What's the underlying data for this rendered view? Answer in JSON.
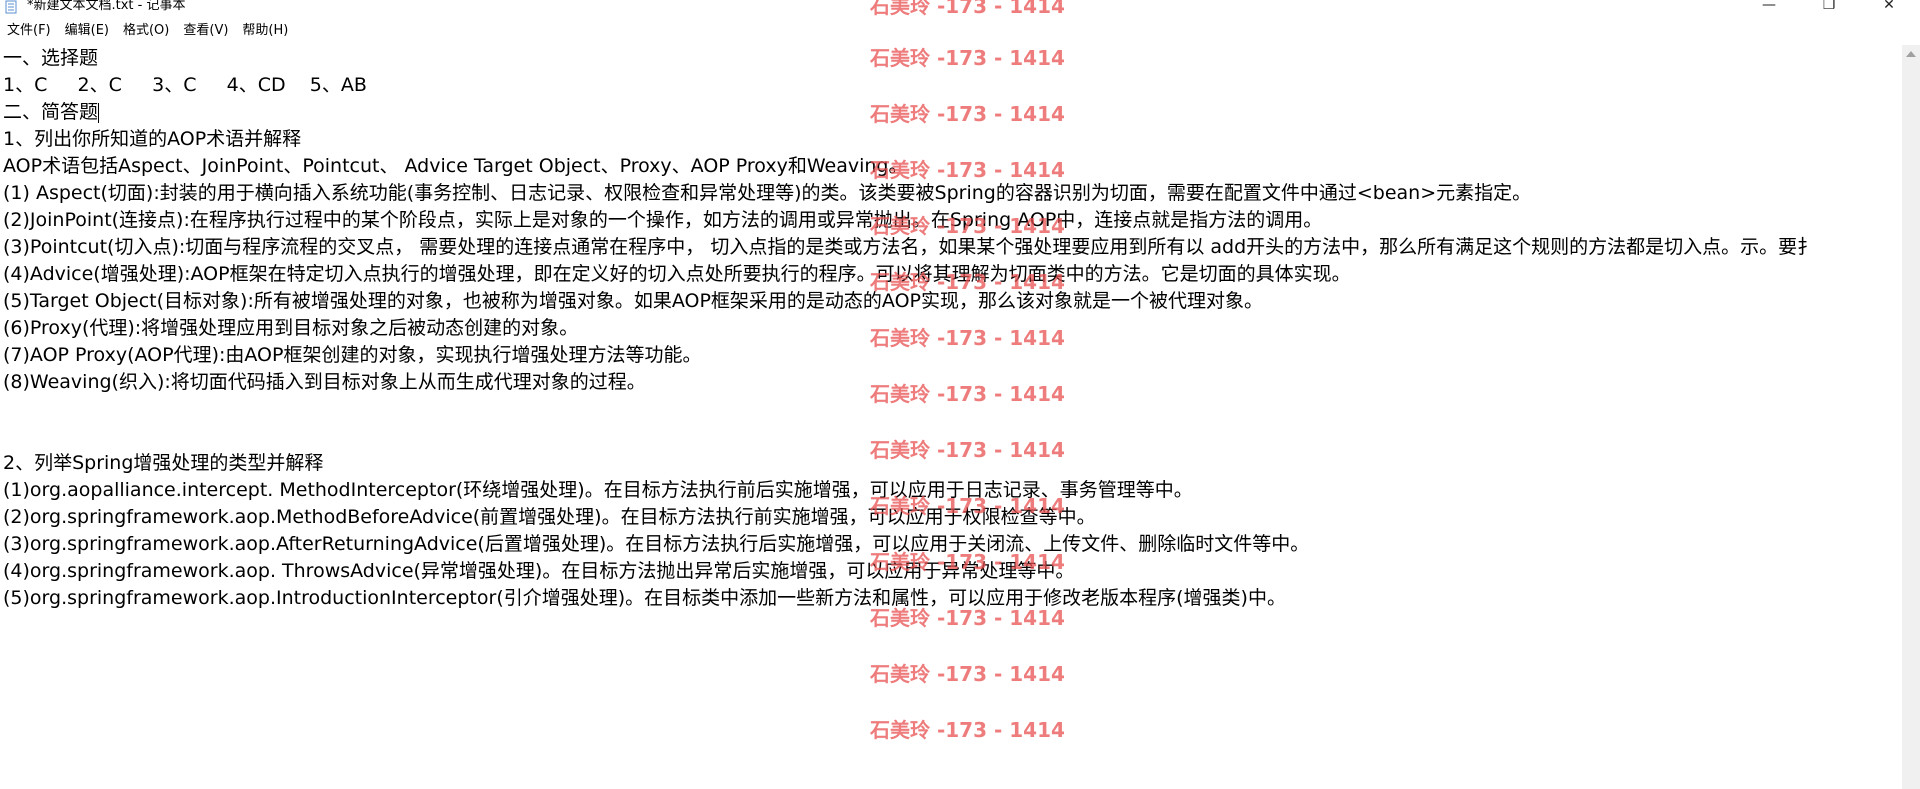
{
  "window": {
    "title": "*新建文本文档.txt - 记事本",
    "minimize_glyph": "—",
    "maximize_glyph": "❐",
    "close_glyph": "✕"
  },
  "menu": [
    "文件(F)",
    "编辑(E)",
    "格式(O)",
    "查看(V)",
    "帮助(H)"
  ],
  "lines": [
    "一、选择题",
    "1、C     2、C     3、C     4、CD    5、AB",
    "二、简答题",
    "1、列出你所知道的AOP术语并解释",
    "AOP术语包括Aspect、JoinPoint、Pointcut、 Advice Target Object、Proxy、AOP Proxy和Weaving。",
    "(1) Aspect(切面):封装的用于横向插入系统功能(事务控制、日志记录、权限检查和异常处理等)的类。该类要被Spring的容器识别为切面，需要在配置文件中通过<bean>元素指定。",
    "(2)JoinPoint(连接点):在程序执行过程中的某个阶段点，实际上是对象的一个操作，如方法的调用或异常抛出。在Spring AOP中，连接点就是指方法的调用。",
    "(3)Pointcut(切入点):切面与程序流程的交叉点， 需要处理的连接点通常在程序中， 切入点指的是类或方法名，如果某个强处理要应用到所有以 add开头的方法中，那么所有满足这个规则的方法都是切入点。示。要扌",
    "(4)Advice(增强处理):AOP框架在特定切入点执行的增强处理，即在定义好的切入点处所要执行的程序。可以将其理解为切面类中的方法。它是切面的具体实现。",
    "(5)Target Object(目标对象):所有被增强处理的对象，也被称为增强对象。如果AOP框架采用的是动态的AOP实现，那么该对象就是一个被代理对象。",
    "(6)Proxy(代理):将增强处理应用到目标对象之后被动态创建的对象。",
    "(7)AOP Proxy(AOP代理):由AOP框架创建的对象，实现执行增强处理方法等功能。",
    "(8)Weaving(织入):将切面代码插入到目标对象上从而生成代理对象的过程。",
    "",
    "",
    "2、列举Spring增强处理的类型并解释",
    "(1)org.aopalliance.intercept. MethodInterceptor(环绕增强处理)。在目标方法执行前后实施增强，可以应用于日志记录、事务管理等中。",
    "(2)org.springframework.aop.MethodBeforeAdvice(前置增强处理)。在目标方法执行前实施增强，可以应用于权限检查等中。",
    "(3)org.springframework.aop.AfterReturningAdvice(后置增强处理)。在目标方法执行后实施增强，可以应用于关闭流、上传文件、删除临时文件等中。",
    "(4)org.springframework.aop. ThrowsAdvice(异常增强处理)。在目标方法抛出异常后实施增强，可以应用于异常处理等中。",
    "(5)org.springframework.aop.IntroductionInterceptor(引介增强处理)。在目标类中添加一些新方法和属性，可以应用于修改老版本程序(增强类)中。"
  ],
  "watermark": {
    "text": "石美玲 -173 - 1414",
    "color": "#e85050",
    "count": 14
  },
  "colors": {
    "background": "#ffffff",
    "text": "#000000",
    "scrollbar": "#f0f0f0"
  }
}
